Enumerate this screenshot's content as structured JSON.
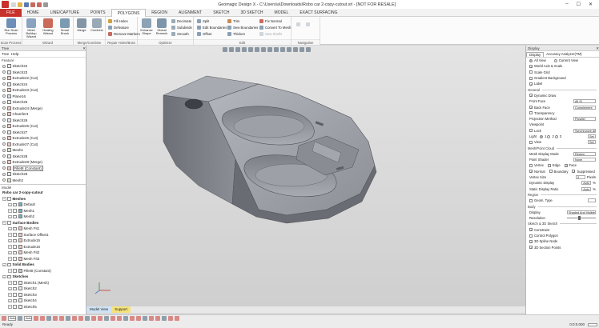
{
  "window": {
    "title": "Geomagic Design X - C:\\Users\\a\\Downloads\\Robo car 2-copy-cutout.xrl - [NOT FOR RESALE]"
  },
  "ribbon_tabs": [
    "FILE",
    "HOME",
    "LINE/CAPTURE",
    "POINTS",
    "POLYGONS",
    "REGION",
    "ALIGNMENT",
    "SKETCH",
    "3D SKETCH",
    "MODEL",
    "EXACT SURFACING"
  ],
  "active_tab": "POLYGONS",
  "ribbon": {
    "scan_process": {
      "label": "Scan Process",
      "buttons": [
        "Run Scan Process"
      ]
    },
    "wizard": {
      "label": "Wizard",
      "buttons": [
        "Mesh Buildup Wizard",
        "Healing Wizard",
        "Smart Brush"
      ]
    },
    "merge": {
      "label": "Merge/Combine",
      "buttons": [
        "Merge",
        "Combine"
      ]
    },
    "repair": {
      "label": "Repair Holes/Boss",
      "buttons": [
        "Fill Holes",
        "Defeature",
        "Remove Markers"
      ]
    },
    "optimize": {
      "label": "Optimize",
      "big": [
        "Enhance Shape",
        "Global Remesh"
      ],
      "small": [
        "Decimate",
        "Subdivide",
        "Smooth"
      ]
    },
    "edit": {
      "label": "Edit",
      "small": [
        "Split",
        "Edit Boundaries",
        "Offset",
        "Trim",
        "Sew Boundaries",
        "Thicken",
        "Fix Normal",
        "Convert To Mesh",
        "Sew Shells"
      ]
    },
    "navigation": {
      "label": "Navigation"
    }
  },
  "left_panel": {
    "header": "Tree",
    "tabs": [
      "Tree",
      "Help"
    ],
    "feature_label": "Feature",
    "features": [
      "Sketch22",
      "Sketch23",
      "Extrude22 (Cut)",
      "Sketch24",
      "Extrude23 (Cut)",
      "Plane16",
      "Sketch25",
      "Extrude24 (Merge)",
      "Chamfer3",
      "Sketch26",
      "Extrude25 (Cut)",
      "Sketch27",
      "Extrude26 (Cut)",
      "Extrude27 (Cut)",
      "Mesh1",
      "Sketch28",
      "Extrude28 (Merge)",
      "Fillet8 (Constant)",
      "Sketch29",
      "Mesh2"
    ],
    "highlighted_feature": "Fillet8 (Constant)",
    "model_label": "Model",
    "model_root": "Robo car 2-copy-cutout",
    "meshes_title": "Meshes",
    "meshes": [
      "Default",
      "Mesh1",
      "Mesh2"
    ],
    "surface_title": "Surface Bodies",
    "surfaces": [
      "Mesh Fit1",
      "Surface Offset1",
      "Extrude15",
      "Extrude16",
      "Mesh Fit2",
      "Mesh Fit3"
    ],
    "solid_title": "Solid Bodies",
    "solids": [
      "Fillet8 (Constant)"
    ],
    "sketches_title": "Sketches",
    "sketches": [
      "Sketch1 (Mesh)",
      "Sketch2",
      "Sketch3",
      "Sketch4",
      "Sketch5"
    ]
  },
  "view_tabs": [
    "Model View",
    "Support"
  ],
  "right_panel": {
    "header": "Display",
    "tabs": [
      "Display",
      "Accuracy Analyzer(TM)"
    ],
    "view_options": [
      "All View",
      "Current View"
    ],
    "checks": [
      {
        "label": "World Axis & Scale",
        "on": true
      },
      {
        "label": "Scale Grid",
        "on": false
      },
      {
        "label": "Gradient Background",
        "on": false
      },
      {
        "label": "Label",
        "on": true
      }
    ],
    "general_title": "General",
    "general": [
      {
        "label": "Dynamic Draw",
        "on": true,
        "field": ""
      },
      {
        "label": "Front Face",
        "on": null,
        "field": "All Sl"
      },
      {
        "label": "Back Face",
        "on": true,
        "field": "Complement"
      },
      {
        "label": "Transparency",
        "on": false,
        "field": ""
      },
      {
        "label": "Projection Method",
        "on": null,
        "field": "Parallel"
      },
      {
        "label": "Viewpoint",
        "on": null,
        "field": ""
      },
      {
        "label": "Lock",
        "on": false,
        "field": "Synchronize All Vi"
      },
      {
        "label": "Light",
        "on": null,
        "field": "Set"
      },
      {
        "label": "View",
        "on": false,
        "field": "Set"
      }
    ],
    "light_options": [
      "1",
      "2",
      "3"
    ],
    "mesh_title": "Mesh/Point Cloud",
    "mesh_rows": [
      {
        "label": "Mesh Display Mode",
        "field": "Region"
      },
      {
        "label": "Point Shader",
        "field": "None"
      }
    ],
    "mesh_checks": [
      "Vertex",
      "Edge",
      "Face",
      "Normal",
      "Boundary",
      "Suppressed"
    ],
    "mesh_checks_on": [
      "Face",
      "Normal",
      "Suppressed"
    ],
    "vertex_size_label": "Vertex Size",
    "vertex_size_value": "3",
    "vertex_size_unit": "Pixels",
    "dynamic_display_label": "Dynamic Display",
    "dynamic_display_value": "Auto",
    "static_display_label": "Static Display Ratio",
    "static_display_value": "Auto",
    "percent": "%",
    "region_title": "Region",
    "region_rows": [
      {
        "label": "Geom. Type",
        "on": false,
        "field": ""
      }
    ],
    "body_title": "Body",
    "body_rows": [
      {
        "label": "Display",
        "field": "Shaded And Visible"
      },
      {
        "label": "Resolution",
        "field": ""
      }
    ],
    "sketch_title": "Sketch & 3D Sketch",
    "sketch_rows": [
      {
        "label": "Constraint",
        "on": true
      },
      {
        "label": "Control Polygon",
        "on": false
      },
      {
        "label": "3D Spline Node",
        "on": true
      },
      {
        "label": "3D Section Points",
        "on": true
      }
    ]
  },
  "status": {
    "ready": "Ready",
    "select_mode": "Auto",
    "filter_mode": "Auto",
    "time": "0:0:0.000"
  },
  "colors": {
    "file_tab": "#c8312c",
    "active_tab_bg": "#ffffff",
    "viewport_top": "#e4e4e4",
    "viewport_bottom": "#cfcfcf",
    "model_gray": "#9a9ca4"
  }
}
